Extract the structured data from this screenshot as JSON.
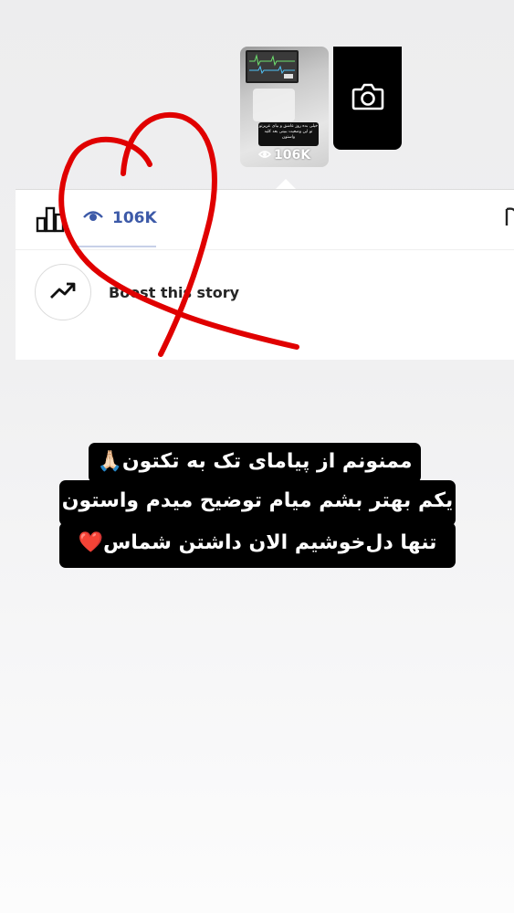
{
  "story_thumbnail": {
    "view_count": "106K",
    "caption": "خیلی بده روز عاشق و بیای عزیزتو تو این وضعیت ببینی بعد کلید واستون"
  },
  "camera_button": {
    "icon": "camera-icon"
  },
  "insights_panel": {
    "stats_icon": "bar-chart-icon",
    "views_tab": {
      "icon": "eye-icon",
      "label": "106K"
    },
    "boost": {
      "icon": "trending-up-icon",
      "label": "Boost this story"
    }
  },
  "overlay": {
    "drawing": "heart-doodle",
    "drawing_color": "#e00000",
    "text_lines": [
      "ممنونم از پیامای تک به تکتون🙏🏻",
      "یکم بهتر بشم میام توضیح میدم واستون",
      "تنها دل‌خوشیم الان داشتن شماس❤️"
    ]
  },
  "colors": {
    "accent": "#3d5aa8",
    "text_bg": "#000000"
  }
}
